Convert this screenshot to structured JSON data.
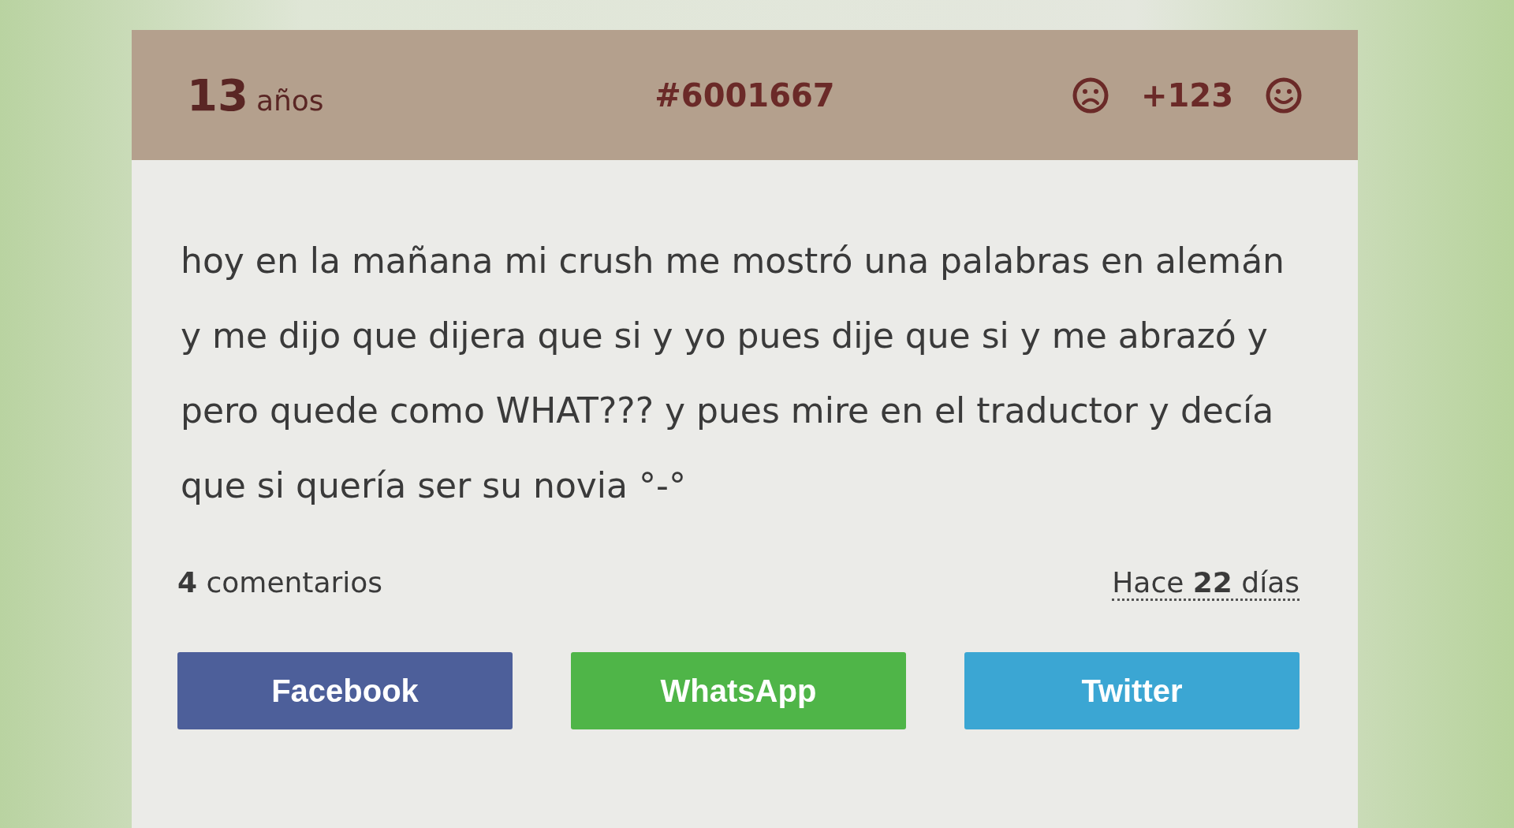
{
  "header": {
    "age": "13",
    "age_unit": "años",
    "id": "#6001667",
    "score": "+123"
  },
  "story": "hoy en la mañana mi crush me mostró una palabras en alemán y me dijo que dijera que si y yo pues dije que si y me abrazó y pero quede como WHAT??? y pues mire en el traductor y decía que si quería ser su novia °-°",
  "comments": "**4** comentarios",
  "time": "Hace **22** días",
  "share_buttons": [
    {
      "label": "Facebook",
      "color": "#4d5f9a"
    },
    {
      "label": "WhatsApp",
      "color": "#4fb548"
    },
    {
      "label": "Twitter",
      "color": "#3ba6d3"
    }
  ]
}
